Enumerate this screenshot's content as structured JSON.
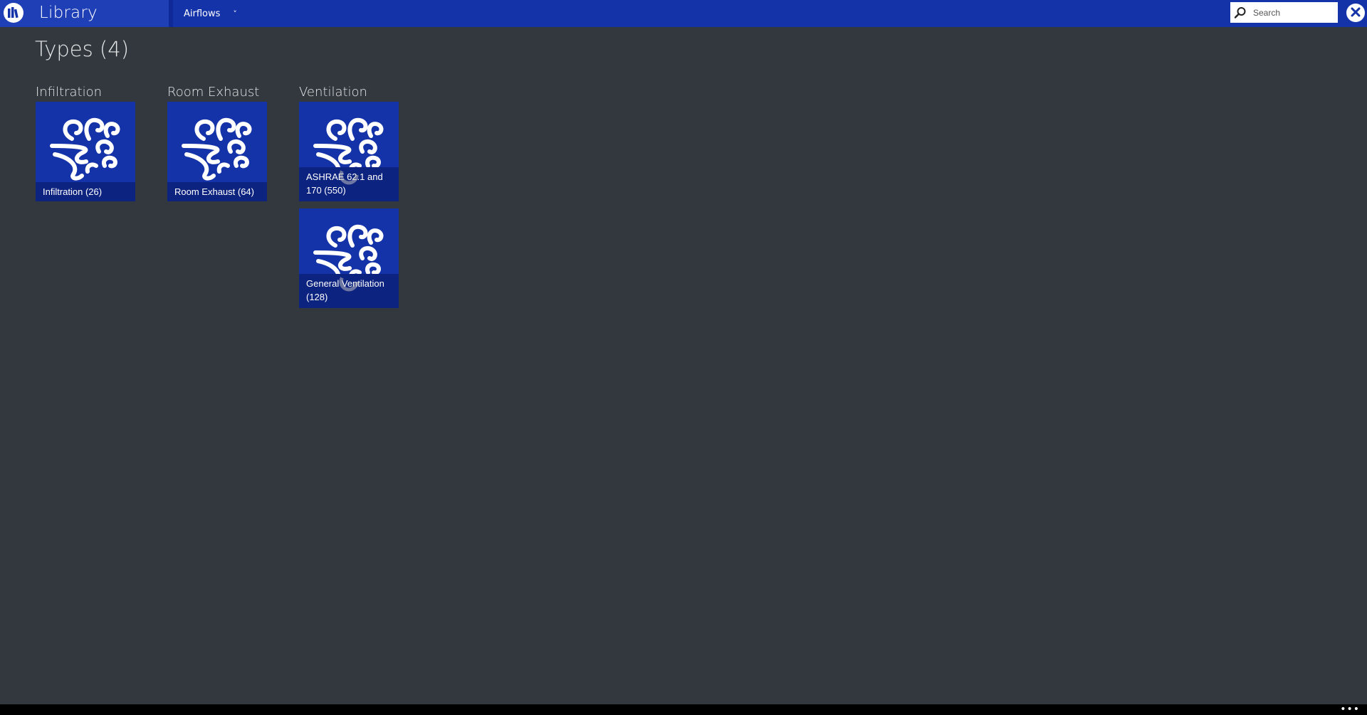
{
  "app": {
    "title": "Library",
    "icon": "library-icon"
  },
  "nav": {
    "selected": "Airflows",
    "chevron": "˅"
  },
  "search": {
    "placeholder": "Search",
    "icon": "search-icon"
  },
  "close": {
    "icon": "close-icon"
  },
  "page": {
    "title": "Types (4)"
  },
  "groups": [
    {
      "title": "Infiltration",
      "tiles": [
        {
          "label": "Infiltration (26)",
          "icon": "wind-icon",
          "loading": false
        }
      ]
    },
    {
      "title": "Room Exhaust",
      "tiles": [
        {
          "label": "Room Exhaust (64)",
          "icon": "wind-icon",
          "loading": false
        }
      ]
    },
    {
      "title": "Ventilation",
      "tiles": [
        {
          "label": "ASHRAE 62.1 and 170 (550)",
          "icon": "wind-icon",
          "loading": true
        },
        {
          "label": "General Ventilation (128)",
          "icon": "wind-icon",
          "loading": true
        }
      ]
    }
  ],
  "bottom": {
    "more": "•••"
  },
  "colors": {
    "accent": "#1433a8",
    "tile_caption": "#0d2380",
    "background": "#32383d"
  }
}
